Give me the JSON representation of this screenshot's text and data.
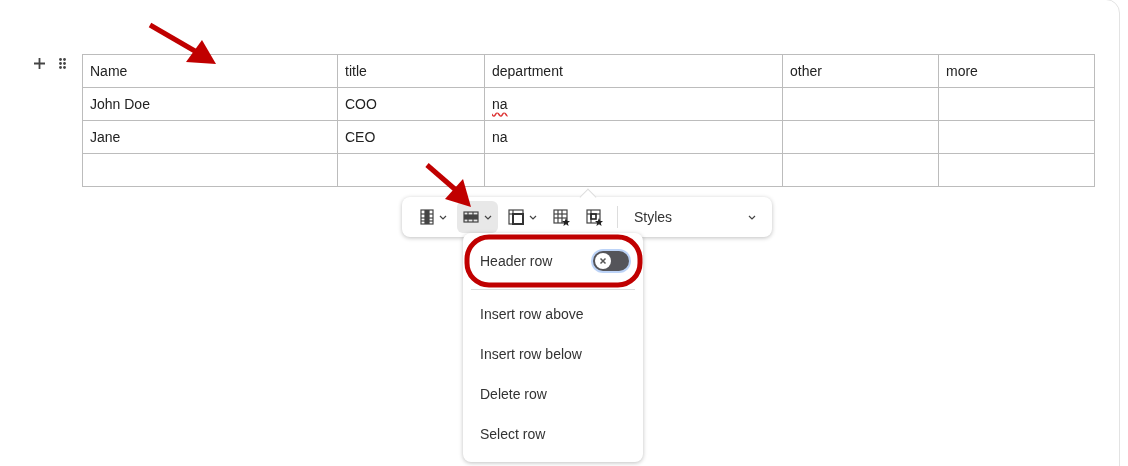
{
  "table": {
    "columns": [
      "Name",
      "title",
      "department",
      "other",
      "more"
    ],
    "rows": [
      [
        {
          "text": "John Doe",
          "misspelled": false
        },
        {
          "text": "COO",
          "misspelled": false
        },
        {
          "text": "na",
          "misspelled": true
        },
        null,
        null
      ],
      [
        {
          "text": "Jane",
          "misspelled": false
        },
        {
          "text": "CEO",
          "misspelled": false
        },
        {
          "text": "na",
          "misspelled": false
        },
        null,
        null
      ],
      [
        null,
        null,
        null,
        null,
        null
      ]
    ]
  },
  "toolbar": {
    "buttons": [
      {
        "kind": "columns",
        "dropdown": true,
        "selected": false
      },
      {
        "kind": "rows",
        "dropdown": true,
        "selected": true
      },
      {
        "kind": "cells",
        "dropdown": true,
        "selected": false
      },
      {
        "kind": "table-style",
        "dropdown": false,
        "selected": false
      },
      {
        "kind": "cell-style",
        "dropdown": false,
        "selected": false
      }
    ],
    "styles_label": "Styles"
  },
  "menu": {
    "header_row": {
      "label": "Header row",
      "on": false
    },
    "items": [
      "Insert row above",
      "Insert row below",
      "Delete row",
      "Select row"
    ]
  }
}
